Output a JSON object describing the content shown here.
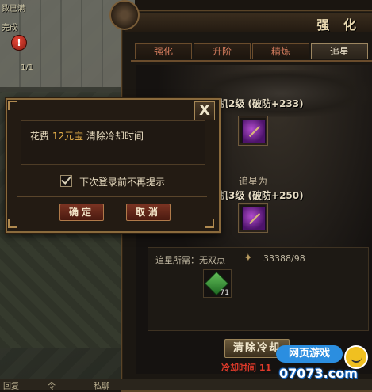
{
  "world": {
    "quest_lines": [
      "数已满",
      "完成",
      "1/1"
    ],
    "alert_badge": "!",
    "bottom_bar": [
      "回复",
      "令",
      "私聊"
    ]
  },
  "panel": {
    "title": "强 化",
    "tabs": [
      {
        "label": "强化",
        "active": false
      },
      {
        "label": "升阶",
        "active": false
      },
      {
        "label": "精炼",
        "active": false
      },
      {
        "label": "追星",
        "active": true
      }
    ],
    "current_level": "机2级 (破防+233)",
    "arrow_label": "追星为",
    "next_level": "机3级 (破防+250)",
    "requirement_label": "追星所需：无双点",
    "requirement_value": "33388/98",
    "material_count": "71",
    "clear_button": "清除冷却",
    "cooldown_text": "冷却时间 11"
  },
  "dialog": {
    "close_label": "X",
    "message_prefix": "花费",
    "message_amount": "12元宝",
    "message_suffix": "清除冷却时间",
    "checkbox_label": "下次登录前不再提示",
    "confirm_label": "确定",
    "cancel_label": "取消"
  },
  "watermark": {
    "brand": "网页游戏",
    "site": "07073.com"
  },
  "colors": {
    "highlight": "#e9b24a",
    "cooldown": "#e03a2a",
    "active_tab_text": "#f0e6cf",
    "tab_text": "#d07a5c"
  }
}
